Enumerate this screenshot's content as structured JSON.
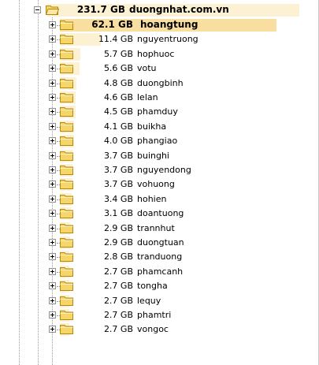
{
  "root": {
    "size": "231.7 GB",
    "name": "duongnhat.com.vn"
  },
  "items": [
    {
      "size": "62.1 GB",
      "name": "hoangtung"
    },
    {
      "size": "11.4 GB",
      "name": "nguyentruong"
    },
    {
      "size": "5.7 GB",
      "name": "hophuoc"
    },
    {
      "size": "5.6 GB",
      "name": "votu"
    },
    {
      "size": "4.8 GB",
      "name": "duongbinh"
    },
    {
      "size": "4.6 GB",
      "name": "lelan"
    },
    {
      "size": "4.5 GB",
      "name": "phamduy"
    },
    {
      "size": "4.1 GB",
      "name": "buikha"
    },
    {
      "size": "4.0 GB",
      "name": "phangiao"
    },
    {
      "size": "3.7 GB",
      "name": "buinghi"
    },
    {
      "size": "3.7 GB",
      "name": "nguyendong"
    },
    {
      "size": "3.7 GB",
      "name": "vohuong"
    },
    {
      "size": "3.4 GB",
      "name": "hohien"
    },
    {
      "size": "3.1 GB",
      "name": "doantuong"
    },
    {
      "size": "2.9 GB",
      "name": "trannhut"
    },
    {
      "size": "2.9 GB",
      "name": "duongtuan"
    },
    {
      "size": "2.8 GB",
      "name": "tranduong"
    },
    {
      "size": "2.7 GB",
      "name": "phamcanh"
    },
    {
      "size": "2.7 GB",
      "name": "tongha"
    },
    {
      "size": "2.7 GB",
      "name": "lequy"
    },
    {
      "size": "2.7 GB",
      "name": "phamtri"
    },
    {
      "size": "2.7 GB",
      "name": "vongoc"
    }
  ]
}
